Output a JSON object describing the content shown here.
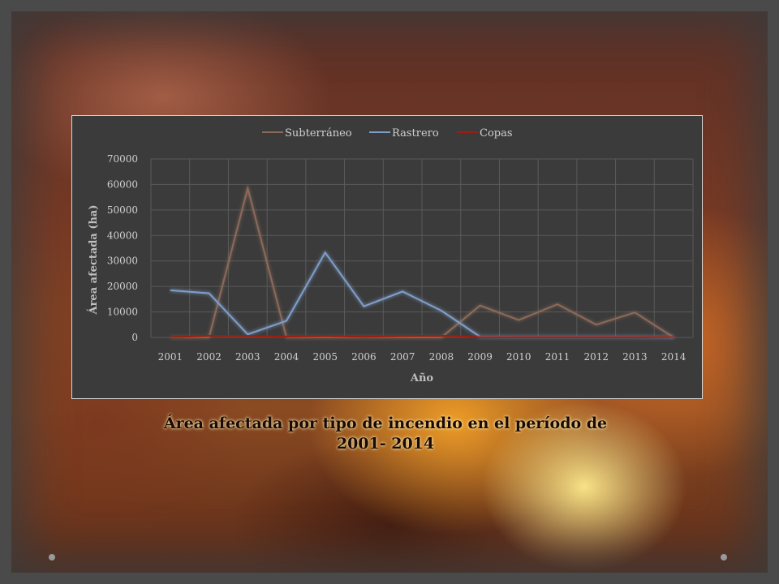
{
  "chart_data": {
    "type": "line",
    "title": "",
    "xlabel": "Año",
    "ylabel": "Área afectada (ha)",
    "categories": [
      "2001",
      "2002",
      "2003",
      "2004",
      "2005",
      "2006",
      "2007",
      "2008",
      "2009",
      "2010",
      "2011",
      "2012",
      "2013",
      "2014"
    ],
    "ylim": [
      0,
      70000
    ],
    "yticks": [
      "0",
      "10000",
      "20000",
      "30000",
      "40000",
      "50000",
      "60000",
      "70000"
    ],
    "grid": true,
    "legend": "top",
    "series": [
      {
        "name": "Subterráneo",
        "color": "#8b6a5a",
        "values": [
          0,
          0,
          58500,
          0,
          0,
          0,
          0,
          0,
          12500,
          6800,
          13000,
          5000,
          9800,
          0
        ]
      },
      {
        "name": "Rastrero",
        "color": "#7f9ec9",
        "values": [
          18500,
          17300,
          1200,
          6500,
          33300,
          12200,
          18000,
          10500,
          300,
          200,
          200,
          200,
          200,
          100
        ]
      },
      {
        "name": "Copas",
        "color": "#a01c10",
        "values": [
          0,
          700,
          500,
          300,
          600,
          200,
          600,
          700,
          100,
          100,
          100,
          100,
          100,
          50
        ]
      }
    ]
  },
  "caption": {
    "line1": "Área afectada por tipo de incendio en el período de",
    "line2": "2001- 2014"
  }
}
